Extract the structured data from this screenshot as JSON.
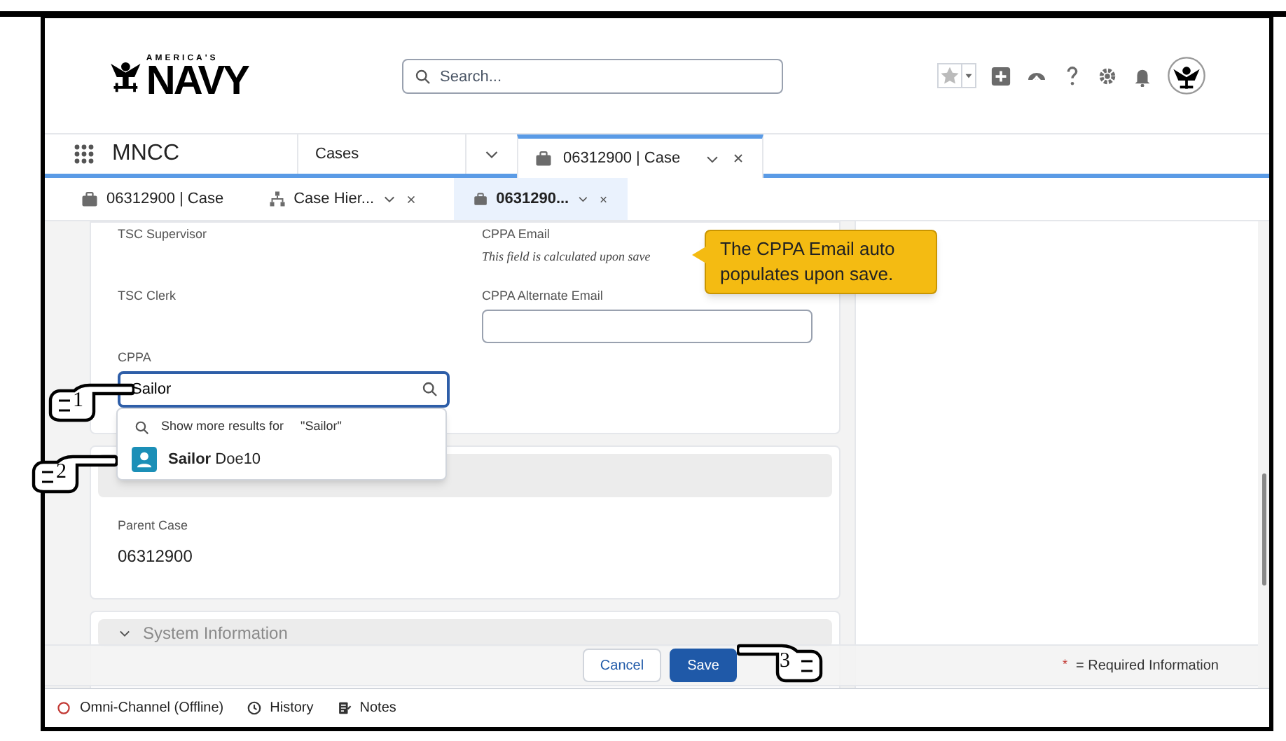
{
  "header": {
    "logo": {
      "tagline": "AMERICA'S",
      "wordmark": "NAVY"
    },
    "search": {
      "placeholder": "Search..."
    }
  },
  "app_nav": {
    "app_name": "MNCC",
    "tabs": [
      {
        "label": "Cases",
        "selected": false,
        "kind": "object"
      },
      {
        "label": "06312900 | Case",
        "selected": true,
        "kind": "record"
      }
    ]
  },
  "subtabs": [
    {
      "label": "06312900 | Case",
      "kind": "case",
      "selected": false,
      "closable": false
    },
    {
      "label": "Case Hier...",
      "kind": "hierarchy",
      "selected": false,
      "closable": true
    },
    {
      "label": "0631290...",
      "kind": "case",
      "selected": true,
      "closable": true
    }
  ],
  "form": {
    "fields": [
      {
        "label": "TSC Supervisor",
        "kind": "empty"
      },
      {
        "label": "CPPA Email",
        "kind": "note",
        "note": "This field is calculated upon save"
      },
      {
        "label": "TSC Clerk",
        "kind": "empty"
      },
      {
        "label": "CPPA Alternate Email",
        "kind": "input"
      },
      {
        "label": "CPPA",
        "kind": "lookup",
        "value": "Sailor"
      }
    ],
    "lookup_dropdown": {
      "more_results": "Show more results for",
      "query": "\"Sailor\"",
      "results": [
        "**Sailor** Doe10"
      ]
    },
    "sections": [
      {
        "fields": [
          {
            "label": "Parent Case",
            "value": "06312900"
          }
        ]
      },
      {
        "title": "System Information"
      }
    ]
  },
  "footer": {
    "buttons": [
      {
        "label": "Cancel",
        "kind": "neutral"
      },
      {
        "label": "Save",
        "kind": "brand"
      }
    ],
    "required_mark": "*",
    "required_text": "= Required Information"
  },
  "utility_bar": [
    {
      "label": "Omni-Channel (Offline)",
      "kind": "status"
    },
    {
      "label": "History",
      "kind": "history"
    },
    {
      "label": "Notes",
      "kind": "notes"
    }
  ],
  "annotations": {
    "callout": "The CPPA Email auto populates upon save.",
    "steps": [
      "1",
      "2",
      "3"
    ]
  }
}
